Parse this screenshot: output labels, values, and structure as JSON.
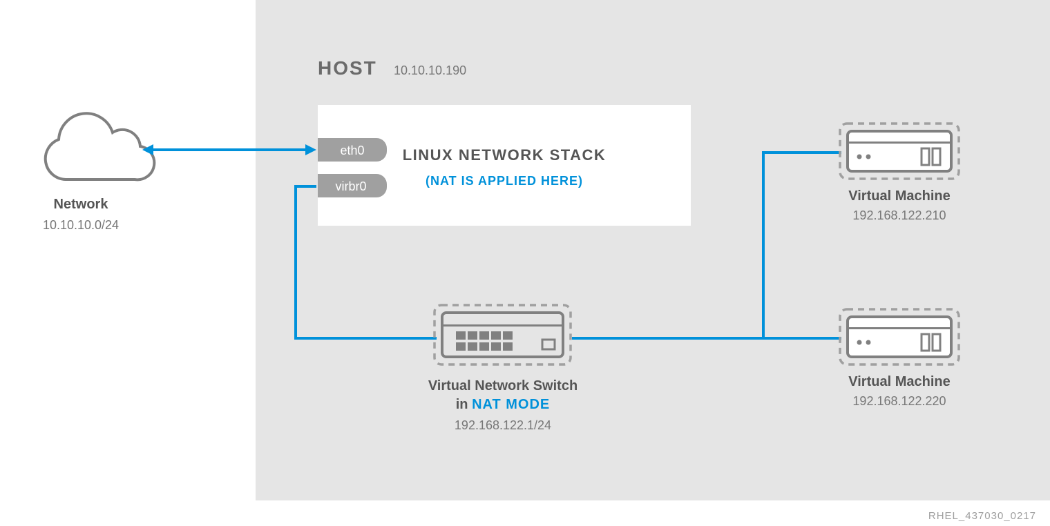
{
  "host": {
    "title": "HOST",
    "ip": "10.10.10.190"
  },
  "network": {
    "label": "Network",
    "cidr": "10.10.10.0/24"
  },
  "stack": {
    "title": "LINUX NETWORK STACK",
    "note": "(NAT IS APPLIED HERE)",
    "if_eth": "eth0",
    "if_virbr": "virbr0"
  },
  "switch": {
    "label1": "Virtual Network Switch",
    "label2_pre": "in ",
    "label2_mode": "NAT MODE",
    "ip": "192.168.122.1/24"
  },
  "vm1": {
    "label": "Virtual Machine",
    "ip": "192.168.122.210"
  },
  "vm2": {
    "label": "Virtual Machine",
    "ip": "192.168.122.220"
  },
  "footer": "RHEL_437030_0217",
  "colors": {
    "bg": "#e5e5e5",
    "blue": "#0091da",
    "gray": "#a0a0a0",
    "darkgray": "#8a8a8a"
  }
}
